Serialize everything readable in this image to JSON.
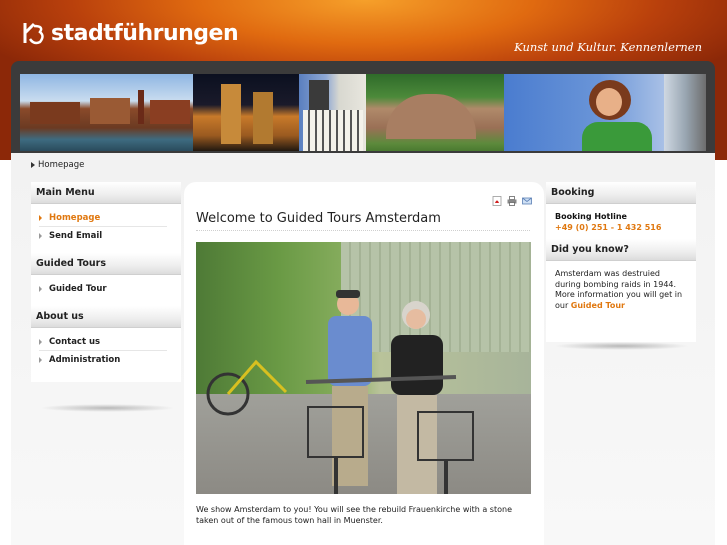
{
  "brand": {
    "logo_text": "stadtführungen",
    "tagline": "Kunst und Kultur. Kennenlernen",
    "accent_color": "#e07810"
  },
  "breadcrumb": {
    "current": "Homepage"
  },
  "main_menu": {
    "title": "Main Menu",
    "items": [
      {
        "label": "Homepage",
        "active": true
      },
      {
        "label": "Send Email",
        "active": false
      }
    ]
  },
  "guided_tours": {
    "title": "Guided Tours",
    "items": [
      {
        "label": "Guided Tour"
      }
    ]
  },
  "about_us": {
    "title": "About us",
    "items": [
      {
        "label": "Contact us"
      },
      {
        "label": "Administration"
      }
    ]
  },
  "content": {
    "title": "Welcome to Guided Tours Amsterdam",
    "icons": [
      "pdf-icon",
      "print-icon",
      "email-icon"
    ],
    "caption": "We show Amsterdam to you! You will see the rebuild Frauenkirche with a stone taken out of the famous town hall in Muenster."
  },
  "booking": {
    "title": "Booking",
    "hotline_label": "Booking Hotline",
    "phone": "+49 (0) 251 - 1 432 516"
  },
  "did_you_know": {
    "title": "Did you know?",
    "text": "Amsterdam was destruied during bombing raids in 1944. More information you will get in our ",
    "link": "Guided Tour"
  }
}
